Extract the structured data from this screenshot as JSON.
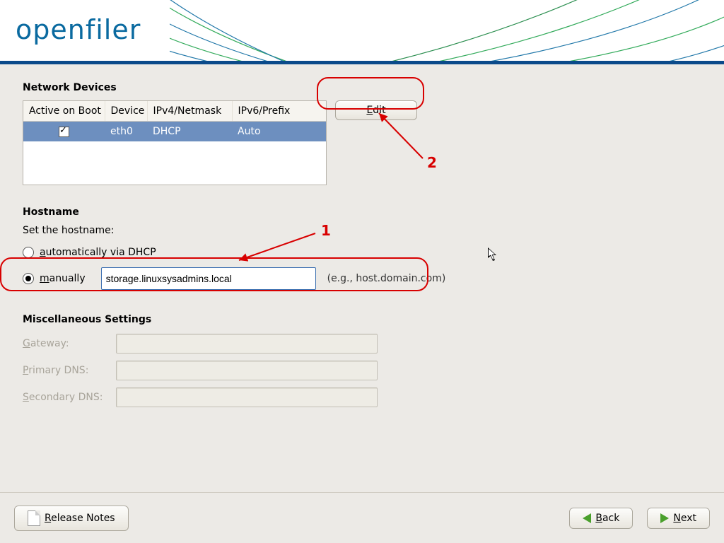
{
  "brand": "openfiler",
  "sections": {
    "network_devices_title": "Network Devices",
    "hostname_title": "Hostname",
    "set_hostname_label": "Set the hostname:",
    "misc_title": "Miscellaneous Settings"
  },
  "net_table": {
    "headers": {
      "active_on_boot": "Active on Boot",
      "device": "Device",
      "ipv4_netmask": "IPv4/Netmask",
      "ipv6_prefix": "IPv6/Prefix"
    },
    "rows": [
      {
        "active": true,
        "device": "eth0",
        "ipv4": "DHCP",
        "ipv6": "Auto",
        "selected": true
      }
    ]
  },
  "buttons": {
    "edit_pre": "E",
    "edit_post": "dit",
    "release_pre": "R",
    "release_post": "elease Notes",
    "back_pre": "B",
    "back_post": "ack",
    "next_pre": "N",
    "next_post": "ext"
  },
  "hostname": {
    "auto_pre": "a",
    "auto_post": "utomatically via DHCP",
    "manual_pre": "m",
    "manual_post": "anually",
    "manual_value": "storage.linuxsysadmins.local",
    "manual_hint": "(e.g., host.domain.com)",
    "auto_selected": false,
    "manual_selected": true
  },
  "misc": {
    "gateway_pre": "G",
    "gateway_post": "ateway:",
    "primary_pre": "P",
    "primary_post": "rimary DNS:",
    "secondary_pre": "S",
    "secondary_post": "econdary DNS:"
  },
  "annotations": {
    "label1": "1",
    "label2": "2"
  }
}
